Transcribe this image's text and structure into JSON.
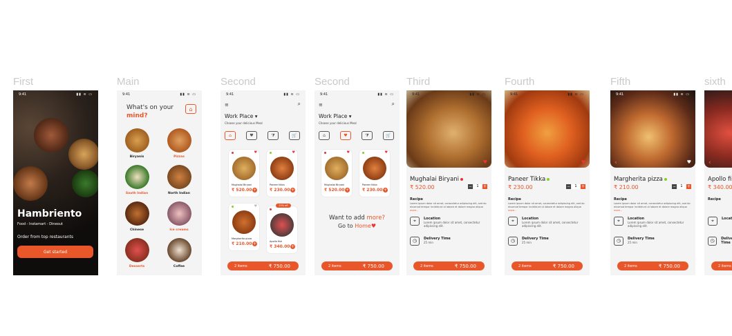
{
  "labels": {
    "first": "First",
    "main": "Main",
    "second_a": "Second",
    "second_b": "Second",
    "third": "Third",
    "fourth": "Fourth",
    "fifth": "Fifth",
    "sixth": "sixth"
  },
  "status_time": "9:41",
  "status_icons": "▮▮ ≋ ▭",
  "first": {
    "brand": "Hambriento",
    "tagline": "Food - Instamart - Dineout",
    "order_text": "Order from top restaurants",
    "cta": "Get started"
  },
  "main": {
    "question_line1": "What's on your",
    "question_line2": "mind?",
    "home_icon": "⌂",
    "categories": [
      "Biryanis",
      "Pizzas",
      "South Indian",
      "North Indian",
      "Chinese",
      "Ice creams",
      "Desserts",
      "Coffee"
    ]
  },
  "second": {
    "menu_icon": "≡",
    "search_icon": "⌕",
    "location": "Work Place ▾",
    "location_sub": "Choose your delicious Meal",
    "filter_icons": [
      "⌂",
      "♥",
      "⧩",
      "🛒"
    ],
    "cards": [
      {
        "name": "Mughalai Biryani",
        "price": "₹ 520.00"
      },
      {
        "name": "Paneer tikka",
        "price": "₹ 230.00"
      },
      {
        "name": "Margherita pizza",
        "price": "₹ 210.00"
      },
      {
        "name": "Apollo fish",
        "price": "₹ 340.00"
      }
    ],
    "heart": "♥",
    "plus": "+",
    "badge": "15% off",
    "cart_items": "2 items",
    "cart_total": "₹ 750.00",
    "want_text_a": "Want to add",
    "want_text_b": "more?",
    "go_text": "Go to",
    "home_text": "Home",
    "home_heart": "♥"
  },
  "detail": {
    "back": "‹",
    "fav": "♥",
    "minus": "−",
    "qty": "1",
    "plus": "+",
    "recipe_label": "Recipe",
    "recipe_text": "Lorem ipsum dolor sit amet, consectetur adipiscing elit, sed do eiusmod tempor incididunt ut labore et dolore magna aliqua",
    "more": "more...",
    "location_label": "Location",
    "location_text": "Lorem ipsum dolor sit amet, consectetur adipiscing elit.",
    "location_icon": "⌖",
    "delivery_label": "Delivery Time",
    "delivery_text": "25 min",
    "clock_icon": "◷",
    "items": [
      {
        "title": "Mughalai Biryani",
        "price": "₹ 520.00"
      },
      {
        "title": "Paneer Tikka",
        "price": "₹ 230.00"
      },
      {
        "title": "Margherita pizza",
        "price": "₹ 210.00"
      },
      {
        "title": "Apollo fi",
        "price": "₹ 340.00"
      }
    ]
  },
  "colors": {
    "accent": "#e8562a",
    "veg": "#7ed321",
    "nonveg": "#e33333"
  }
}
